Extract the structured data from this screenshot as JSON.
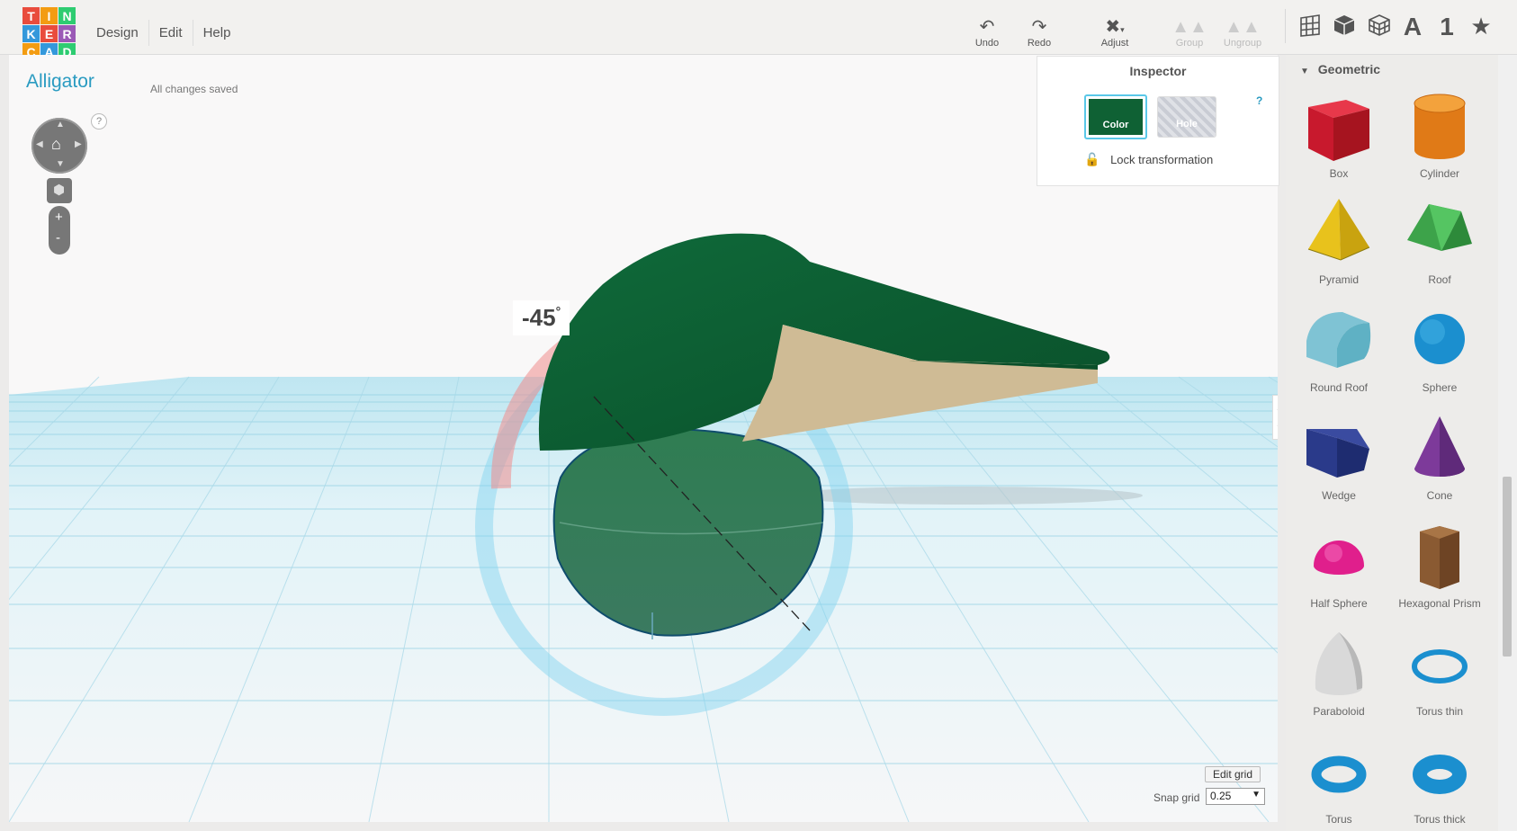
{
  "logo": {
    "letters": [
      "T",
      "I",
      "N",
      "K",
      "E",
      "R",
      "C",
      "A",
      "D"
    ],
    "colors": [
      "#e94c3d",
      "#f39c12",
      "#2ecc71",
      "#3498db",
      "#e94c3d",
      "#9b59b6",
      "#f39c12",
      "#3498db",
      "#2ecc71"
    ]
  },
  "menu": {
    "design": "Design",
    "edit": "Edit",
    "help": "Help"
  },
  "toolbar": {
    "undo": "Undo",
    "redo": "Redo",
    "adjust": "Adjust",
    "group": "Group",
    "ungroup": "Ungroup"
  },
  "right_tools": {
    "text_tool": "A",
    "number_tool": "1",
    "star_tool": "★"
  },
  "design": {
    "title": "Alligator",
    "status": "All changes saved"
  },
  "viewport": {
    "rotation_angle": "-45",
    "degree": "°",
    "edit_grid": "Edit grid",
    "snap_grid_label": "Snap grid",
    "snap_grid_value": "0.25",
    "help": "?"
  },
  "inspector": {
    "title": "Inspector",
    "color_label": "Color",
    "hole_label": "Hole",
    "lock_label": "Lock transformation",
    "help": "?",
    "selected_color": "#0f6134"
  },
  "sidebar": {
    "category": "Geometric",
    "shapes": [
      "Box",
      "Cylinder",
      "Pyramid",
      "Roof",
      "Round Roof",
      "Sphere",
      "Wedge",
      "Cone",
      "Half Sphere",
      "Hexagonal Prism",
      "Paraboloid",
      "Torus thin",
      "Torus",
      "Torus thick"
    ]
  },
  "icons": [
    "undo-icon",
    "redo-icon",
    "adjust-icon",
    "group-icon",
    "ungroup-icon",
    "grid-icon",
    "box-view-icon",
    "wireframe-icon",
    "text-icon",
    "number-icon",
    "star-icon",
    "home-icon",
    "zoom-in-icon",
    "zoom-out-icon",
    "lock-icon",
    "collapse-arrow-icon"
  ]
}
